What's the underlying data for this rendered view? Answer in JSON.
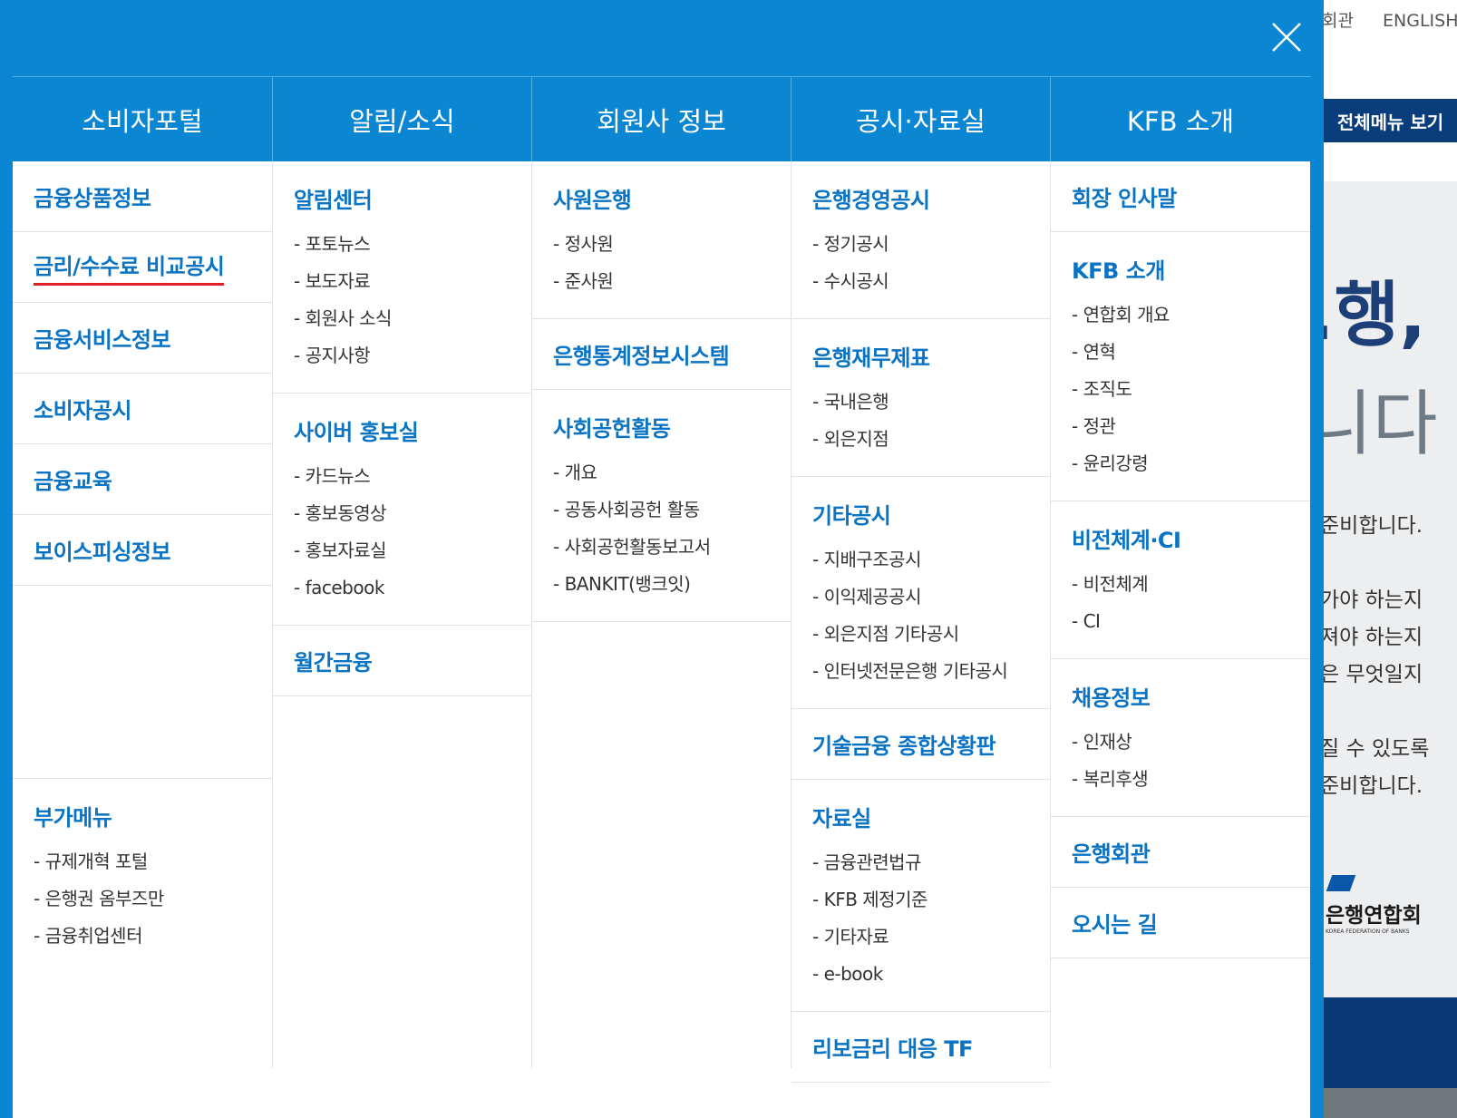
{
  "top_links": [
    "회관",
    "ENGLISH"
  ],
  "all_menu_label": "전체메뉴 보기",
  "hero": {
    "big1": ".행,",
    "big2": "니다",
    "lines": [
      "준비합니다.",
      "가야 하는지",
      "져야 하는지",
      "은 무엇일지",
      "질 수 있도록",
      "준비합니다."
    ],
    "logo": "은행연합회",
    "logo_sub": "KOREA FEDERATION OF BANKS"
  },
  "colors": {
    "overlay": "#0a86d2",
    "link": "#0a73c4",
    "active_underline": "#e21f26",
    "dark_nav": "#0a3d7c"
  },
  "icons": {
    "close": "close-icon"
  },
  "columns": [
    {
      "title": "소비자포털",
      "groups": [
        {
          "title": "금융상품정보",
          "items": []
        },
        {
          "title": "금리/수수료 비교공시",
          "items": [],
          "active": true
        },
        {
          "title": "금융서비스정보",
          "items": []
        },
        {
          "title": "소비자공시",
          "items": []
        },
        {
          "title": "금융교육",
          "items": []
        },
        {
          "title": "보이스피싱정보",
          "items": []
        }
      ],
      "extra": {
        "title": "부가메뉴",
        "items": [
          "- 규제개혁 포털",
          "- 은행권 옴부즈만",
          "- 금융취업센터"
        ]
      }
    },
    {
      "title": "알림/소식",
      "groups": [
        {
          "title": "알림센터",
          "items": [
            "- 포토뉴스",
            "- 보도자료",
            "- 회원사 소식",
            "- 공지사항"
          ]
        },
        {
          "title": "사이버 홍보실",
          "items": [
            "- 카드뉴스",
            "- 홍보동영상",
            "- 홍보자료실",
            "- facebook"
          ]
        },
        {
          "title": "월간금융",
          "items": []
        }
      ]
    },
    {
      "title": "회원사 정보",
      "groups": [
        {
          "title": "사원은행",
          "items": [
            "- 정사원",
            "- 준사원"
          ]
        },
        {
          "title": "은행통계정보시스템",
          "items": []
        },
        {
          "title": "사회공헌활동",
          "items": [
            "- 개요",
            "- 공동사회공헌 활동",
            "- 사회공헌활동보고서",
            "- BANKIT(뱅크잇)"
          ]
        }
      ]
    },
    {
      "title": "공시·자료실",
      "groups": [
        {
          "title": "은행경영공시",
          "items": [
            "- 정기공시",
            "- 수시공시"
          ]
        },
        {
          "title": "은행재무제표",
          "items": [
            "- 국내은행",
            "- 외은지점"
          ]
        },
        {
          "title": "기타공시",
          "items": [
            "- 지배구조공시",
            "- 이익제공공시",
            "- 외은지점 기타공시",
            "- 인터넷전문은행 기타공시"
          ]
        },
        {
          "title": "기술금융 종합상황판",
          "items": []
        },
        {
          "title": "자료실",
          "items": [
            "- 금융관련법규",
            "- KFB 제정기준",
            "- 기타자료",
            "- e-book"
          ]
        },
        {
          "title": "리보금리 대응 TF",
          "items": []
        }
      ]
    },
    {
      "title": "KFB 소개",
      "groups": [
        {
          "title": "회장 인사말",
          "items": []
        },
        {
          "title": "KFB 소개",
          "items": [
            "- 연합회 개요",
            "- 연혁",
            "- 조직도",
            "- 정관",
            "- 윤리강령"
          ]
        },
        {
          "title": "비전체계·CI",
          "items": [
            "- 비전체계",
            "- CI"
          ]
        },
        {
          "title": "채용정보",
          "items": [
            "- 인재상",
            "- 복리후생"
          ]
        },
        {
          "title": "은행회관",
          "items": []
        },
        {
          "title": "오시는 길",
          "items": []
        }
      ]
    }
  ]
}
